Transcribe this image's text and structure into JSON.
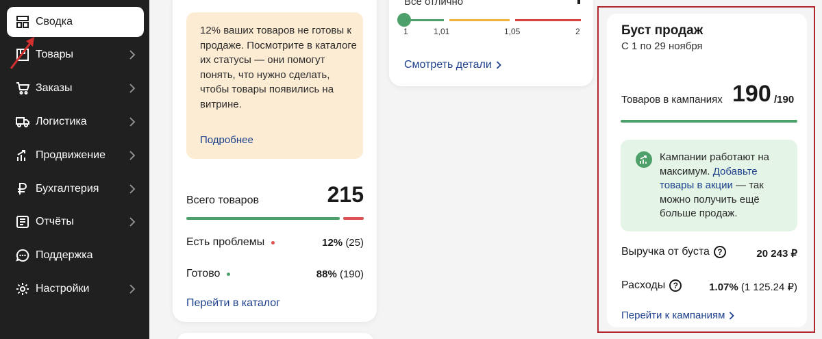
{
  "sidebar": {
    "items": [
      {
        "label": "Сводка",
        "icon": "dashboard-icon"
      },
      {
        "label": "Товары",
        "icon": "box-icon"
      },
      {
        "label": "Заказы",
        "icon": "cart-icon"
      },
      {
        "label": "Логистика",
        "icon": "truck-icon"
      },
      {
        "label": "Продвижение",
        "icon": "chart-growth-icon"
      },
      {
        "label": "Бухгалтерия",
        "icon": "ruble-icon"
      },
      {
        "label": "Отчёты",
        "icon": "report-icon"
      },
      {
        "label": "Поддержка",
        "icon": "chat-icon"
      },
      {
        "label": "Настройки",
        "icon": "gear-icon"
      }
    ]
  },
  "products_card": {
    "warning_text": "12% ваших товаров не готовы к продаже. Посмотрите в каталоге их статусы — они помогут понять, что нужно сделать, чтобы товары появились на витрине.",
    "warning_link": "Подробнее",
    "total_label": "Всего товаров",
    "total_value": "215",
    "problems_label": "Есть проблемы",
    "problems_pct": "12%",
    "problems_count": "(25)",
    "ready_label": "Готово",
    "ready_pct": "88%",
    "ready_count": "(190)",
    "catalog_link": "Перейти в каталог"
  },
  "rating_card": {
    "status_text": "Всё отлично",
    "ticks": [
      "1",
      "1,01",
      "1,05",
      "2"
    ],
    "details_link": "Смотреть детали"
  },
  "boost_card": {
    "title": "Буст продаж",
    "period": "С 1 по 29 ноября",
    "campaign_label": "Товаров в кампаниях",
    "campaign_count": "190",
    "campaign_total": "/190",
    "info_text_1": "Кампании работают на максимум.",
    "info_link": "Добавьте товары в акции",
    "info_text_2": "— так можно получить ещё больше продаж.",
    "revenue_label": "Выручка от буста",
    "revenue_value": "20 243 ₽",
    "expenses_label": "Расходы",
    "expenses_pct": "1.07%",
    "expenses_value": "(1 125.24 ₽)",
    "campaigns_link": "Перейти к кампаниям"
  },
  "colors": {
    "green": "#4ea06a",
    "red": "#e05252",
    "link": "#1c3f8c",
    "highlight_frame": "#b0262b"
  }
}
